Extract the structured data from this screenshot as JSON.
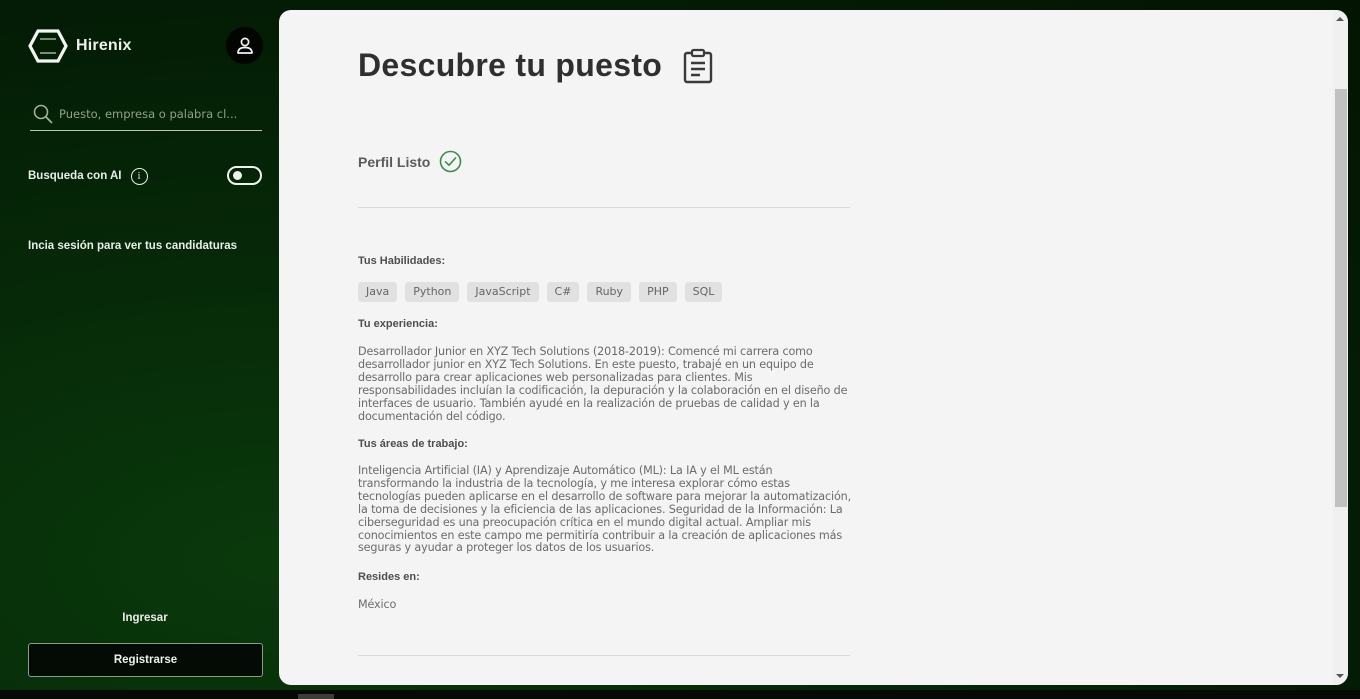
{
  "app": {
    "name": "Hirenix",
    "brand_color": "#062a08",
    "accent_color": "#3f8a4e"
  },
  "sidebar": {
    "profile_icon": "user-icon",
    "search": {
      "icon": "search-icon",
      "placeholder": "Puesto, empresa o palabra cl...",
      "value": ""
    },
    "ai_search": {
      "label": "Busqueda con AI",
      "info_icon": "info-icon",
      "info_glyph": "i",
      "enabled": false
    },
    "candidaturas_text": "Incia sesión para ver tus candidaturas",
    "login_label": "Ingresar",
    "register_label": "Registrarse"
  },
  "main": {
    "title": "Descubre tu puesto",
    "title_icon": "clipboard-icon",
    "profile_status": {
      "label": "Perfil Listo",
      "icon": "check-circle-icon"
    },
    "skills": {
      "label": "Tus Habilidades:",
      "items": [
        "Java",
        "Python",
        "JavaScript",
        "C#",
        "Ruby",
        "PHP",
        "SQL"
      ]
    },
    "experience": {
      "label": "Tu experiencia:",
      "text": "Desarrollador Junior en XYZ Tech Solutions (2018-2019): Comencé mi carrera como desarrollador junior en XYZ Tech Solutions. En este puesto, trabajé en un equipo de desarrollo para crear aplicaciones web personalizadas para clientes. Mis responsabilidades incluían la codificación, la depuración y la colaboración en el diseño de interfaces de usuario. También ayudé en la realización de pruebas de calidad y en la documentación del código."
    },
    "areas": {
      "label": "Tus áreas de trabajo:",
      "text": "Inteligencia Artificial (IA) y Aprendizaje Automático (ML): La IA y el ML están transformando la industria de la tecnología, y me interesa explorar cómo estas tecnologías pueden aplicarse en el desarrollo de software para mejorar la automatización, la toma de decisiones y la eficiencia de las aplicaciones. Seguridad de la Información: La ciberseguridad es una preocupación crítica en el mundo digital actual. Ampliar mis conocimientos en este campo me permitiría contribuir a la creación de aplicaciones más seguras y ayudar a proteger los datos de los usuarios."
    },
    "location": {
      "label": "Resides en:",
      "value": "México"
    }
  }
}
